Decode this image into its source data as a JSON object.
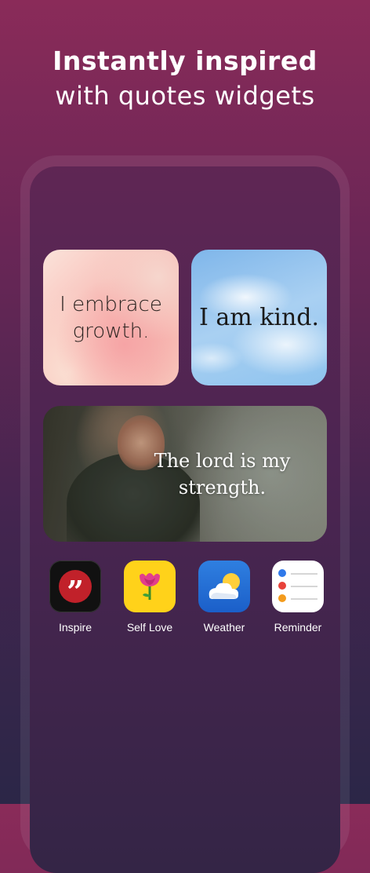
{
  "headline": {
    "line1": "Instantly inspired",
    "line2": "with quotes widgets"
  },
  "widgets": [
    {
      "id": "growth",
      "text": "I embrace growth."
    },
    {
      "id": "kind",
      "text": "I am kind."
    },
    {
      "id": "lord",
      "text": "The lord is my strength."
    }
  ],
  "apps": [
    {
      "label": "Inspire",
      "icon": "quote-icon"
    },
    {
      "label": "Self Love",
      "icon": "flower-icon"
    },
    {
      "label": "Weather",
      "icon": "sun-cloud-icon"
    },
    {
      "label": "Reminder",
      "icon": "checklist-icon"
    }
  ],
  "colors": {
    "background_top": "#8a2b59",
    "background_bottom": "#2b2647",
    "inspire_red": "#c1212a",
    "selflove_yellow": "#ffd21a",
    "weather_blue": "#2f7fe0"
  }
}
